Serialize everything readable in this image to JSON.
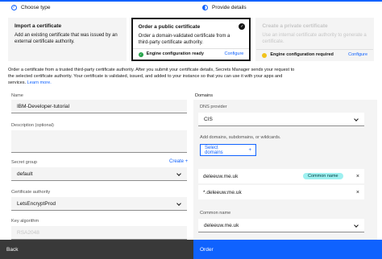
{
  "steps": [
    {
      "label": "Choose type"
    },
    {
      "label": "Provide details"
    }
  ],
  "tiles": [
    {
      "title": "Import a certificate",
      "desc": "Add an existing certificate that was issued by an external certificate authority."
    },
    {
      "title": "Order a public certificate",
      "desc": "Order a domain-validated certificate from a third-party certificate authority.",
      "status": "Engine configuration ready",
      "link": "Configure"
    },
    {
      "title": "Create a private certificate",
      "desc": "Use an internal certificate authority to generate a certificate.",
      "status": "Engine configuration required",
      "link": "Configure"
    }
  ],
  "intro": {
    "text": "Order a certificate from a trusted third-party certificate authority. After you submit your certificate details, Secrets Manager sends your request to the selected certificate authority. Your certificate is validated, issued, and added to your instance so that you can use it with your apps and services.",
    "link": "Learn more."
  },
  "form": {
    "name_label": "Name",
    "name_value": "IBM-Developer-tutorial",
    "desc_label": "Description (optional)",
    "group_label": "Secret group",
    "group_create": "Create +",
    "group_value": "default",
    "ca_label": "Certificate authority",
    "ca_value": "LetsEncryptProd",
    "key_label": "Key algorithm",
    "key_value": "RSA2048"
  },
  "domains": {
    "header": "Domains",
    "dns_label": "DNS provider",
    "dns_value": "CIS",
    "add_label": "Add domains, subdomains, or wildcards.",
    "select_button": "Select domains",
    "select_plus": "+",
    "rows": [
      {
        "name": "deleeuw.me.uk",
        "tag": "Common name"
      },
      {
        "name": "*.deleeuw.me.uk",
        "tag": ""
      }
    ],
    "common_label": "Common name",
    "common_value": "deleeuw.me.uk"
  },
  "footer": {
    "back": "Back",
    "order": "Order"
  }
}
